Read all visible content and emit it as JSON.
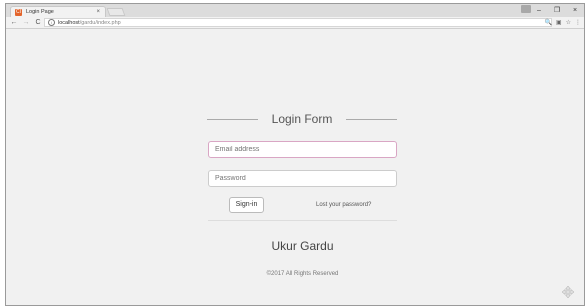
{
  "browser": {
    "tab_title": "Login Page",
    "tab_close": "×",
    "favicon": "CI",
    "nav_back": "←",
    "nav_forward": "→",
    "nav_reload": "C",
    "url_host": "localhost",
    "url_path": "/gardu/index.php",
    "win_min": "–",
    "win_max": "❐",
    "win_close": "×",
    "zoom_icon": "🔍",
    "ext_icon": "▣",
    "star_icon": "☆",
    "menu_icon": "⋮"
  },
  "form": {
    "title": "Login Form",
    "email_placeholder": "Email address",
    "password_placeholder": "Password",
    "signin_label": "Sign-in",
    "lost_password": "Lost your password?"
  },
  "footer": {
    "brand": "Ukur Gardu",
    "copyright": "©2017 All Rights Reserved"
  },
  "colors": {
    "focus_border": "#d9a6c4",
    "background": "#f1f1f1"
  }
}
